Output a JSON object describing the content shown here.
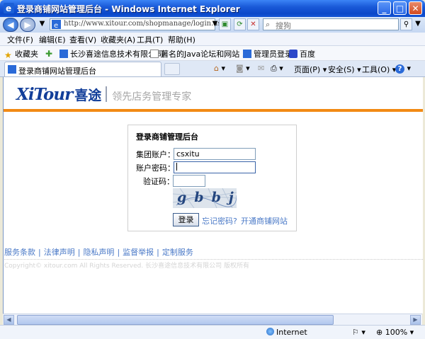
{
  "window": {
    "title": "登录商铺网站管理后台 - Windows Internet Explorer"
  },
  "address": {
    "url": "http://www.xitour.com/shopmanage/login.aspx",
    "search_placeholder": "搜狗"
  },
  "menu": [
    "文件(F)",
    "编辑(E)",
    "查看(V)",
    "收藏夹(A)",
    "工具(T)",
    "帮助(H)"
  ],
  "favorites": {
    "label": "收藏夹",
    "items": [
      "长沙喜途信息技术有限公司",
      "著名的Java论坛和网站 ...",
      "管理员登录",
      "百度"
    ]
  },
  "tab": {
    "label": "登录商铺网站管理后台"
  },
  "toolbar": {
    "page": "页面(P)",
    "safety": "安全(S)",
    "tools": "工具(O)"
  },
  "site": {
    "logo": "XiTour",
    "logo_cn": "喜途",
    "slogan": "领先店务管理专家"
  },
  "login": {
    "title": "登录商铺管理后台",
    "group_label": "集团账户：",
    "group_value": "csxitu",
    "password_label": "账户密码：",
    "password_value": "",
    "captcha_label": "验证码：",
    "captcha_value": "",
    "captcha_text": "gbbj",
    "submit": "登录",
    "forgot": "忘记密码?",
    "register": "开通商铺网站"
  },
  "footer": {
    "links": [
      "服务条款",
      "法律声明",
      "隐私声明",
      "监督举报",
      "定制服务"
    ],
    "copyright": "Copyright© xitour.com All Rights Reserved. 长沙喜途信息技术有限公司 版权所有"
  },
  "status": {
    "zone": "Internet",
    "zoom": "100%"
  },
  "colors": {
    "accent_orange": "#f28a14",
    "logo_blue": "#123e99",
    "link_blue": "#4a79c7"
  }
}
